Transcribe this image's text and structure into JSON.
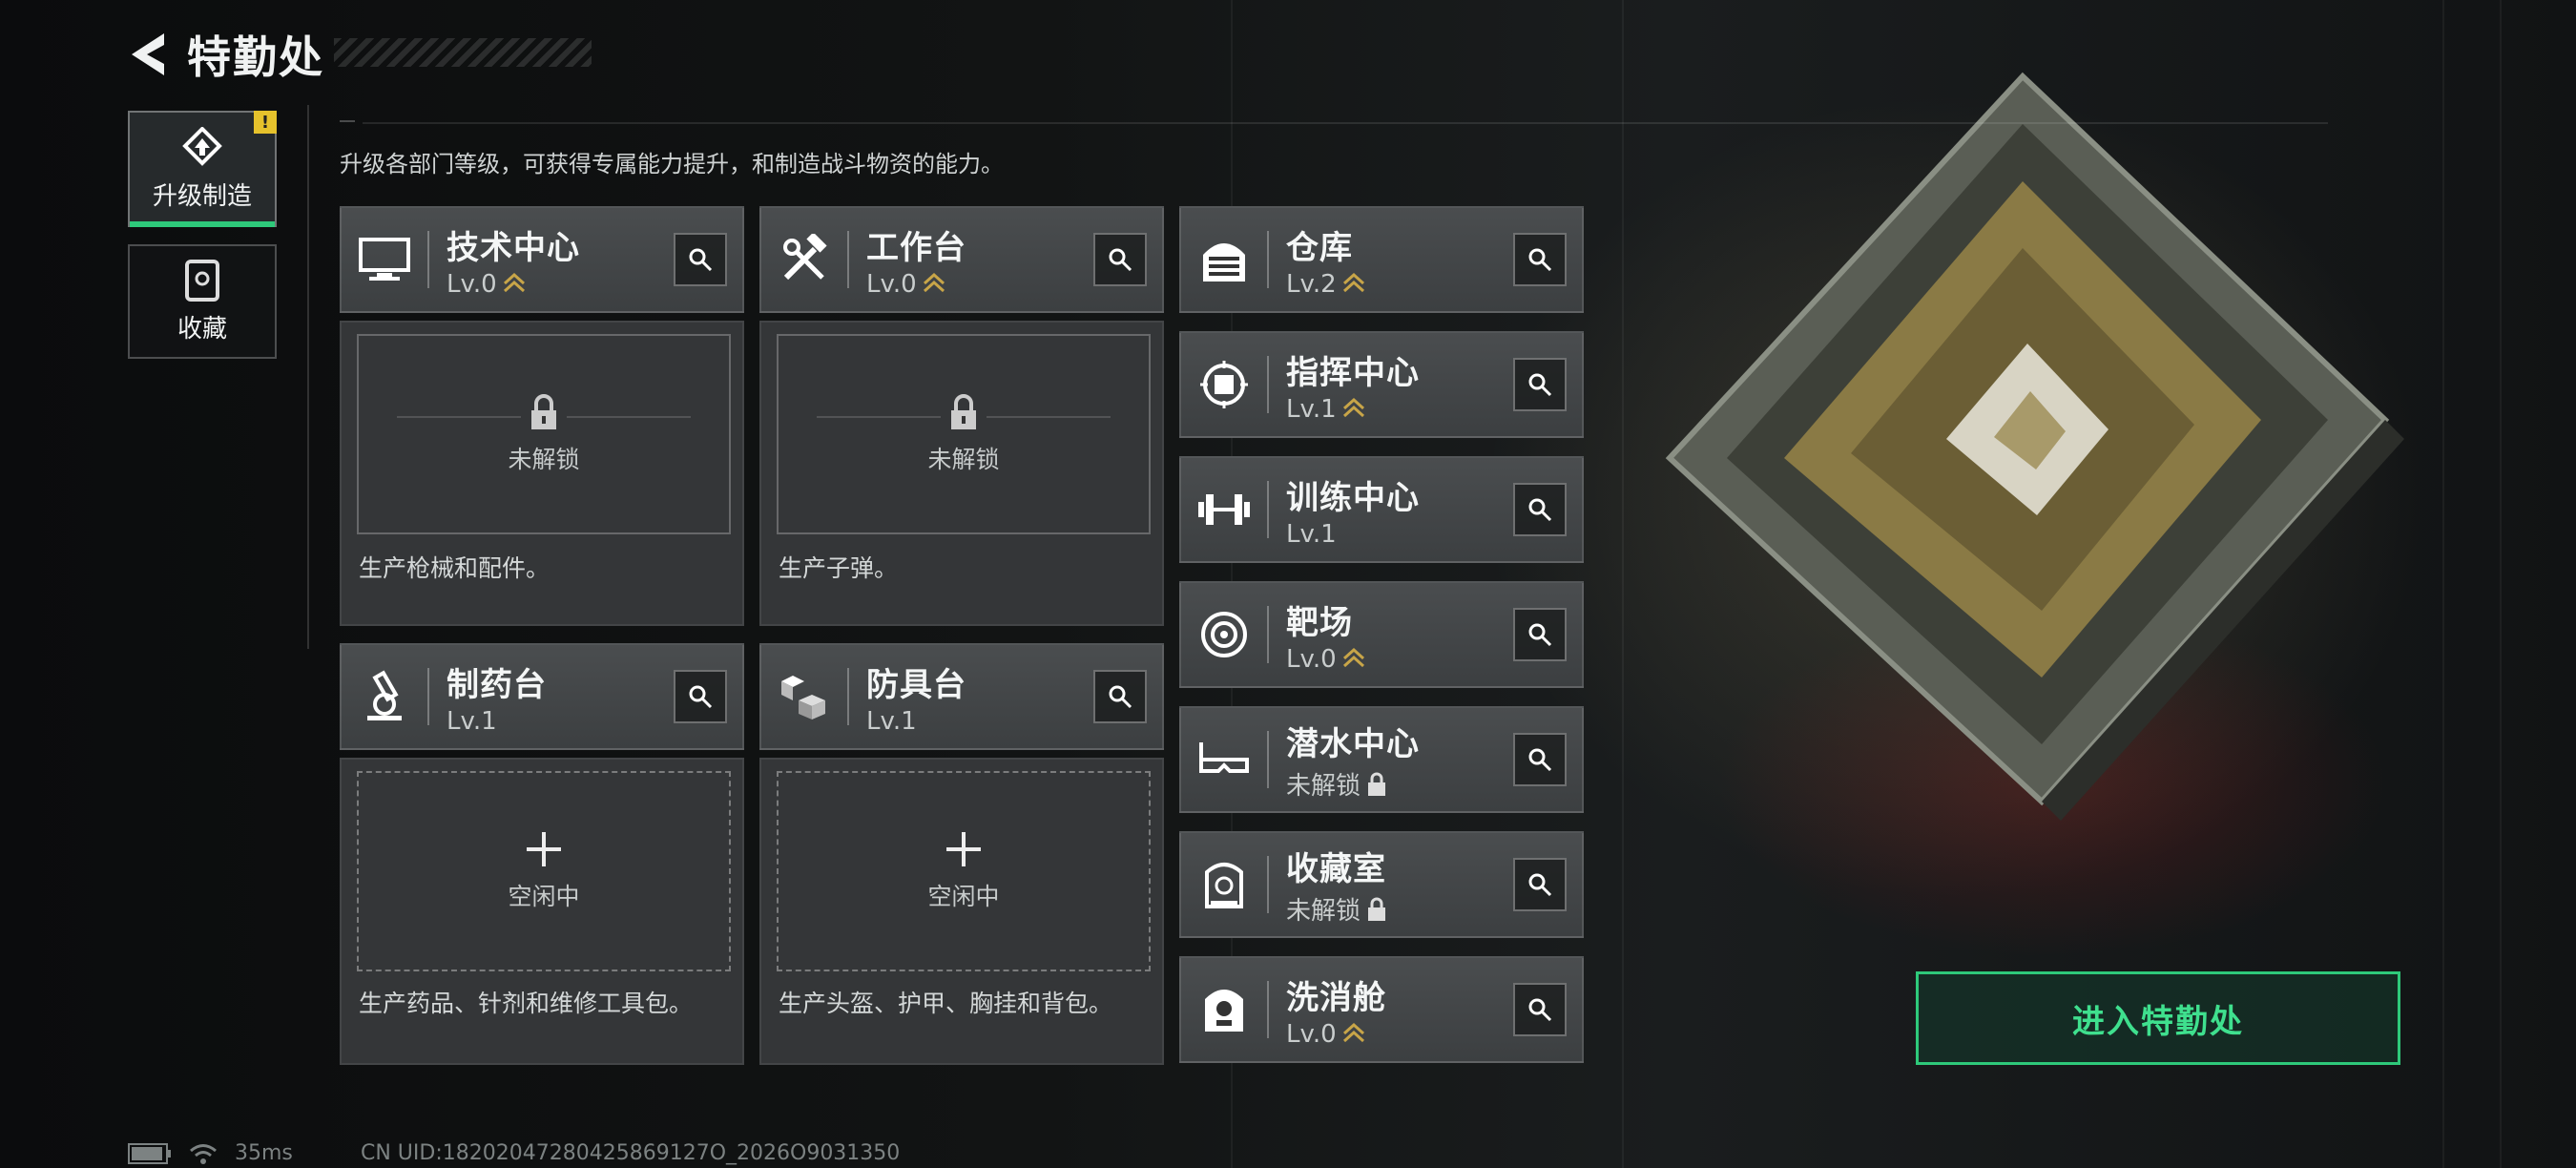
{
  "header": {
    "title": "特勤处"
  },
  "tabs": [
    {
      "label": "升级制造",
      "badge": "!",
      "icon": "upgrade-icon"
    },
    {
      "label": "收藏",
      "icon": "collection-icon"
    }
  ],
  "description": "升级各部门等级，可获得专属能力提升，和制造战斗物资的能力。",
  "departments": [
    {
      "name": "技术中心",
      "level": "Lv.0",
      "icon": "monitor-icon",
      "upgradable": true
    },
    {
      "name": "工作台",
      "level": "Lv.0",
      "icon": "tools-icon",
      "upgradable": true
    },
    {
      "name": "制药台",
      "level": "Lv.1",
      "icon": "microscope-icon",
      "upgradable": false
    },
    {
      "name": "防具台",
      "level": "Lv.1",
      "icon": "armor-blocks-icon",
      "upgradable": false
    },
    {
      "name": "仓库",
      "level": "Lv.2",
      "icon": "warehouse-icon",
      "upgradable": true
    },
    {
      "name": "指挥中心",
      "level": "Lv.1",
      "icon": "chip-icon",
      "upgradable": true
    },
    {
      "name": "训练中心",
      "level": "Lv.1",
      "icon": "dumbbell-icon",
      "upgradable": false
    },
    {
      "name": "靶场",
      "level": "Lv.0",
      "icon": "target-icon",
      "upgradable": true
    },
    {
      "name": "潜水中心",
      "level": "未解锁",
      "icon": "diving-mask-icon",
      "locked": true
    },
    {
      "name": "收藏室",
      "level": "未解锁",
      "icon": "display-case-icon",
      "locked": true
    },
    {
      "name": "洗消舱",
      "level": "Lv.0",
      "icon": "decon-chamber-icon",
      "upgradable": true
    }
  ],
  "production": [
    {
      "status": "未解锁",
      "desc": "生产枪械和配件。"
    },
    {
      "status": "未解锁",
      "desc": "生产子弹。"
    },
    {
      "status": "空闲中",
      "desc": "生产药品、针剂和维修工具包。"
    },
    {
      "status": "空闲中",
      "desc": "生产头盔、护甲、胸挂和背包。"
    }
  ],
  "enter_button": "进入特勤处",
  "status_bar": {
    "ping": "35ms",
    "uid": "CN UID:18202047280425869127O_2026O9031350"
  },
  "colors": {
    "accent": "#2ec97a",
    "badge": "#e6c22c",
    "upgrade_arrow": "#c8a548"
  }
}
